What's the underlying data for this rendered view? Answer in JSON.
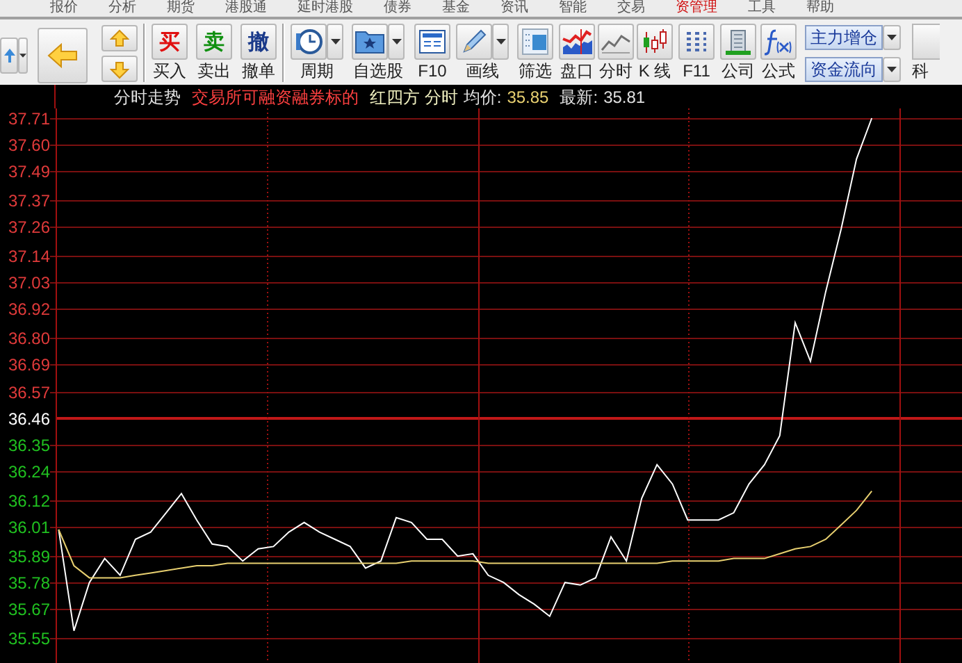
{
  "menu": [
    {
      "label": "报价",
      "highlight": false
    },
    {
      "label": "分析",
      "highlight": false
    },
    {
      "label": "期货",
      "highlight": false
    },
    {
      "label": "港股通",
      "highlight": false
    },
    {
      "label": "延时港股",
      "highlight": false
    },
    {
      "label": "债券",
      "highlight": false
    },
    {
      "label": "基金",
      "highlight": false
    },
    {
      "label": "资讯",
      "highlight": false
    },
    {
      "label": "智能",
      "highlight": false
    },
    {
      "label": "交易",
      "highlight": false
    },
    {
      "label": "资管理",
      "highlight": true
    },
    {
      "label": "工具",
      "highlight": false
    },
    {
      "label": "帮助",
      "highlight": false
    }
  ],
  "toolbar": {
    "buttons": [
      {
        "label": "买入",
        "dropdown": false
      },
      {
        "label": "卖出",
        "dropdown": false
      },
      {
        "label": "撤单",
        "dropdown": false
      },
      {
        "label": "周期",
        "dropdown": true
      },
      {
        "label": "自选股",
        "dropdown": true
      },
      {
        "label": "F10",
        "dropdown": false
      },
      {
        "label": "画线",
        "dropdown": true
      },
      {
        "label": "筛选",
        "dropdown": false
      },
      {
        "label": "盘口",
        "dropdown": false
      },
      {
        "label": "分时",
        "dropdown": false
      },
      {
        "label": "K 线",
        "dropdown": false
      },
      {
        "label": "F11",
        "dropdown": false
      },
      {
        "label": "公司",
        "dropdown": false
      },
      {
        "label": "公式",
        "dropdown": false
      }
    ],
    "icon_glyphs": [
      "买",
      "卖",
      "撤"
    ],
    "selectors": [
      "主力增仓",
      "资金流向"
    ],
    "partial_label": "科"
  },
  "chart_header": {
    "title": "分时走势",
    "tag": "交易所可融资融券标的",
    "stock": "红四方 分时",
    "avg_label": "均价:",
    "avg_value": "35.85",
    "last_label": "最新:",
    "last_value": "35.81"
  },
  "chart_data": {
    "type": "line",
    "ylim": [
      35.44,
      37.71
    ],
    "grid": true,
    "yticks": [
      {
        "value": 37.71,
        "label": "37.71"
      },
      {
        "value": 37.6,
        "label": "37.60"
      },
      {
        "value": 37.49,
        "label": "37.49"
      },
      {
        "value": 37.37,
        "label": "37.37"
      },
      {
        "value": 37.26,
        "label": "37.26"
      },
      {
        "value": 37.14,
        "label": "37.14"
      },
      {
        "value": 37.03,
        "label": "37.03"
      },
      {
        "value": 36.92,
        "label": "36.92"
      },
      {
        "value": 36.8,
        "label": "36.80"
      },
      {
        "value": 36.69,
        "label": "36.69"
      },
      {
        "value": 36.57,
        "label": "36.57"
      },
      {
        "value": 36.46,
        "label": "36.46"
      },
      {
        "value": 36.35,
        "label": "36.35"
      },
      {
        "value": 36.24,
        "label": "36.24"
      },
      {
        "value": 36.12,
        "label": "36.12"
      },
      {
        "value": 36.01,
        "label": "36.01"
      },
      {
        "value": 35.89,
        "label": "35.89"
      },
      {
        "value": 35.78,
        "label": "35.78"
      },
      {
        "value": 35.67,
        "label": "35.67"
      },
      {
        "value": 35.55,
        "label": "35.55"
      }
    ],
    "ref_lines": [
      {
        "axis": "y",
        "value": 36.46
      }
    ],
    "categories": [
      null,
      null,
      null,
      null,
      null,
      null,
      null,
      null,
      null,
      null,
      null,
      null,
      null,
      null,
      null,
      null,
      null,
      null,
      null,
      null,
      null,
      null,
      null,
      null,
      null,
      null,
      null,
      null,
      null,
      null,
      null,
      null,
      null,
      null,
      null,
      null,
      null,
      null,
      null,
      null,
      null,
      null,
      null,
      null,
      null,
      null,
      null,
      null,
      null,
      null,
      null,
      null,
      null,
      null
    ],
    "series": [
      {
        "color": "#ffffff",
        "values": [
          36.0,
          35.58,
          35.78,
          35.88,
          35.81,
          35.96,
          35.99,
          36.07,
          36.15,
          36.04,
          35.94,
          35.93,
          35.87,
          35.92,
          35.93,
          35.99,
          36.03,
          35.99,
          35.96,
          35.93,
          35.84,
          35.87,
          36.05,
          36.03,
          35.96,
          35.96,
          35.89,
          35.9,
          35.81,
          35.78,
          35.73,
          35.69,
          35.64,
          35.78,
          35.77,
          35.8,
          35.97,
          35.87,
          36.13,
          36.27,
          36.19,
          36.04,
          36.04,
          36.04,
          36.07,
          36.19,
          36.27,
          36.39,
          36.86,
          36.7,
          36.99,
          37.25,
          37.54,
          37.71
        ]
      },
      {
        "color": "#e8d070",
        "values": [
          36.0,
          35.85,
          35.8,
          35.8,
          35.8,
          35.81,
          35.82,
          35.83,
          35.84,
          35.85,
          35.85,
          35.86,
          35.86,
          35.86,
          35.86,
          35.86,
          35.86,
          35.86,
          35.86,
          35.86,
          35.86,
          35.86,
          35.86,
          35.87,
          35.87,
          35.87,
          35.87,
          35.87,
          35.86,
          35.86,
          35.86,
          35.86,
          35.86,
          35.86,
          35.86,
          35.86,
          35.86,
          35.86,
          35.86,
          35.86,
          35.87,
          35.87,
          35.87,
          35.87,
          35.88,
          35.88,
          35.88,
          35.9,
          35.92,
          35.93,
          35.96,
          36.02,
          36.08,
          36.16
        ]
      }
    ]
  }
}
